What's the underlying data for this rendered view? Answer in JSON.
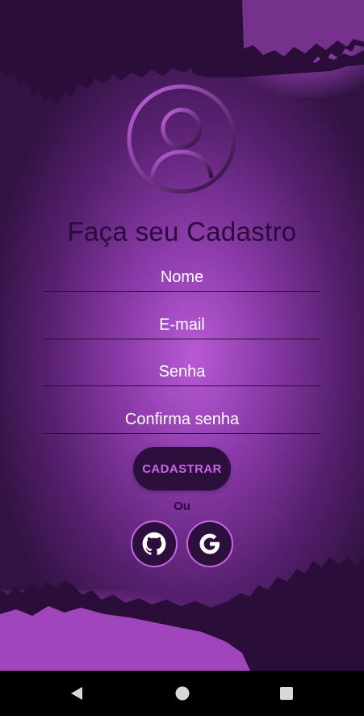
{
  "screen": {
    "title": "Faça seu Cadastro",
    "fields": {
      "name_placeholder": "Nome",
      "email_placeholder": "E-mail",
      "password_placeholder": "Senha",
      "confirm_placeholder": "Confirma senha"
    },
    "register_button": "CADASTRAR",
    "or_label": "Ou",
    "social": {
      "github_icon": "github-icon",
      "google_icon": "google-icon"
    }
  },
  "navbar": {
    "back_icon": "back-triangle-icon",
    "home_icon": "home-circle-icon",
    "recent_icon": "recent-square-icon"
  },
  "colors": {
    "background_light": "#b95ad6",
    "background_dark": "#321243",
    "title_text": "#2a0c38",
    "button_bg": "#2d0f3d",
    "button_text": "#c766e3",
    "field_text": "#ffffff"
  }
}
